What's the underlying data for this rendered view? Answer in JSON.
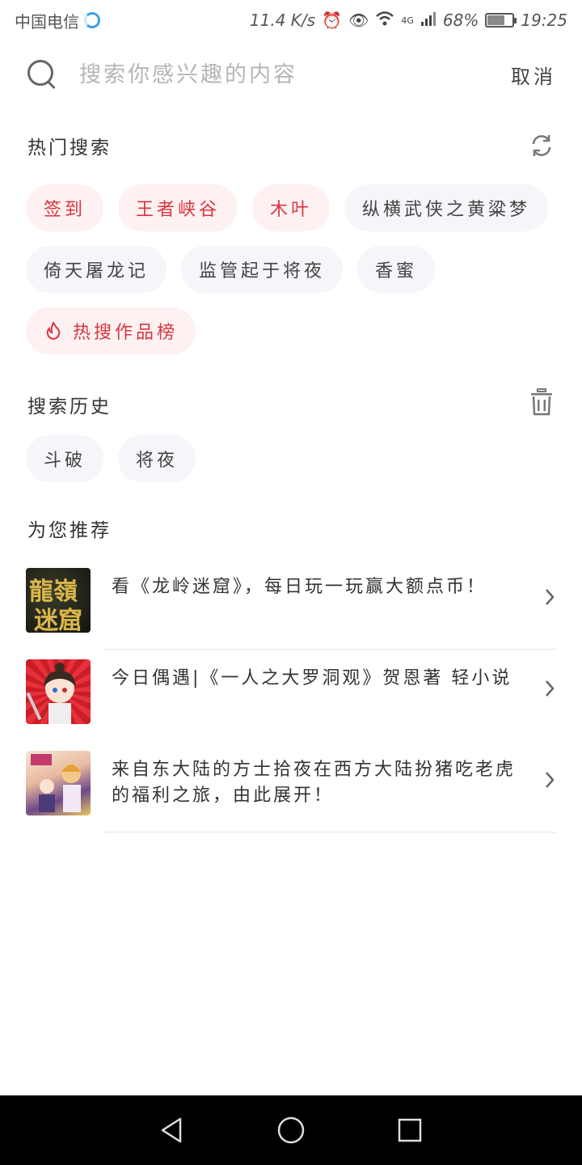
{
  "status_bar": {
    "carrier": "中国电信",
    "speed": "11.4 K/s",
    "network": "4G",
    "battery": "68%",
    "battery_level": 0.68,
    "time": "19:25"
  },
  "search": {
    "placeholder": "搜索你感兴趣的内容",
    "cancel_label": "取消"
  },
  "hot_search": {
    "title": "热门搜索",
    "refresh_icon": "refresh-icon",
    "chips": [
      {
        "label": "签到",
        "hot": true
      },
      {
        "label": "王者峡谷",
        "hot": true
      },
      {
        "label": "木叶",
        "hot": true
      },
      {
        "label": "纵横武侠之黄粱梦",
        "hot": false
      },
      {
        "label": "倚天屠龙记",
        "hot": false
      },
      {
        "label": "监管起于将夜",
        "hot": false
      },
      {
        "label": "香蜜",
        "hot": false
      }
    ],
    "ranking_label": "热搜作品榜",
    "ranking_icon": "fire-icon"
  },
  "history": {
    "title": "搜索历史",
    "delete_icon": "trash-icon",
    "items": [
      "斗破",
      "将夜"
    ]
  },
  "recommend": {
    "title": "为您推荐",
    "items": [
      {
        "text": "看《龙岭迷窟》，每日玩一玩赢大额点币！",
        "thumb_text_1": "龍嶺",
        "thumb_text_2": "迷窟"
      },
      {
        "text": "今日偶遇|《一人之大罗洞观》贺恩著 轻小说"
      },
      {
        "text": "来自东大陆的方士拾夜在西方大陆扮猪吃老虎的福利之旅，由此展开！"
      }
    ]
  },
  "nav": {
    "back_icon": "back-icon",
    "home_icon": "home-icon",
    "recents_icon": "recents-icon"
  },
  "colors": {
    "hot_text": "#d9363e",
    "hot_bg": "#fdf1f2",
    "chip_bg": "#f5f5fa"
  }
}
